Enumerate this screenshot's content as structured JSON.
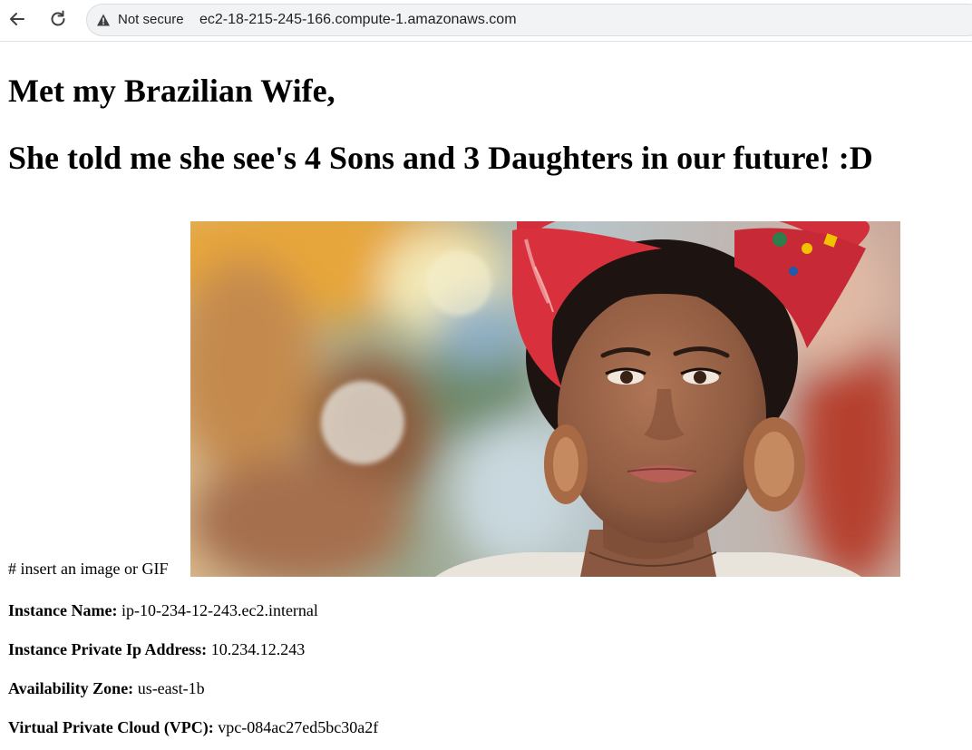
{
  "browser": {
    "security_label": "Not secure",
    "url": "ec2-18-215-245-166.compute-1.amazonaws.com",
    "icons": [
      "back-arrow-icon",
      "reload-icon",
      "warning-icon"
    ]
  },
  "page": {
    "heading_line1": "Met my Brazilian Wife,",
    "heading_line2": "She told me she see's 4 Sons and 3 Daughters in our future! :D",
    "image_caption": "# insert an image or GIF",
    "image_alt": "Portrait of a smiling woman wearing a red patterned headwrap and wooden earrings",
    "info": [
      {
        "label": "Instance Name:",
        "value": "ip-10-234-12-243.ec2.internal"
      },
      {
        "label": "Instance Private Ip Address:",
        "value": "10.234.12.243"
      },
      {
        "label": "Availability Zone:",
        "value": "us-east-1b"
      },
      {
        "label": "Virtual Private Cloud (VPC):",
        "value": "vpc-084ac27ed5bc30a2f"
      }
    ]
  },
  "colors": {
    "omnibox_bg": "#f1f3f4",
    "headwrap_red": "#d8303c",
    "skin": "#a0664a"
  }
}
